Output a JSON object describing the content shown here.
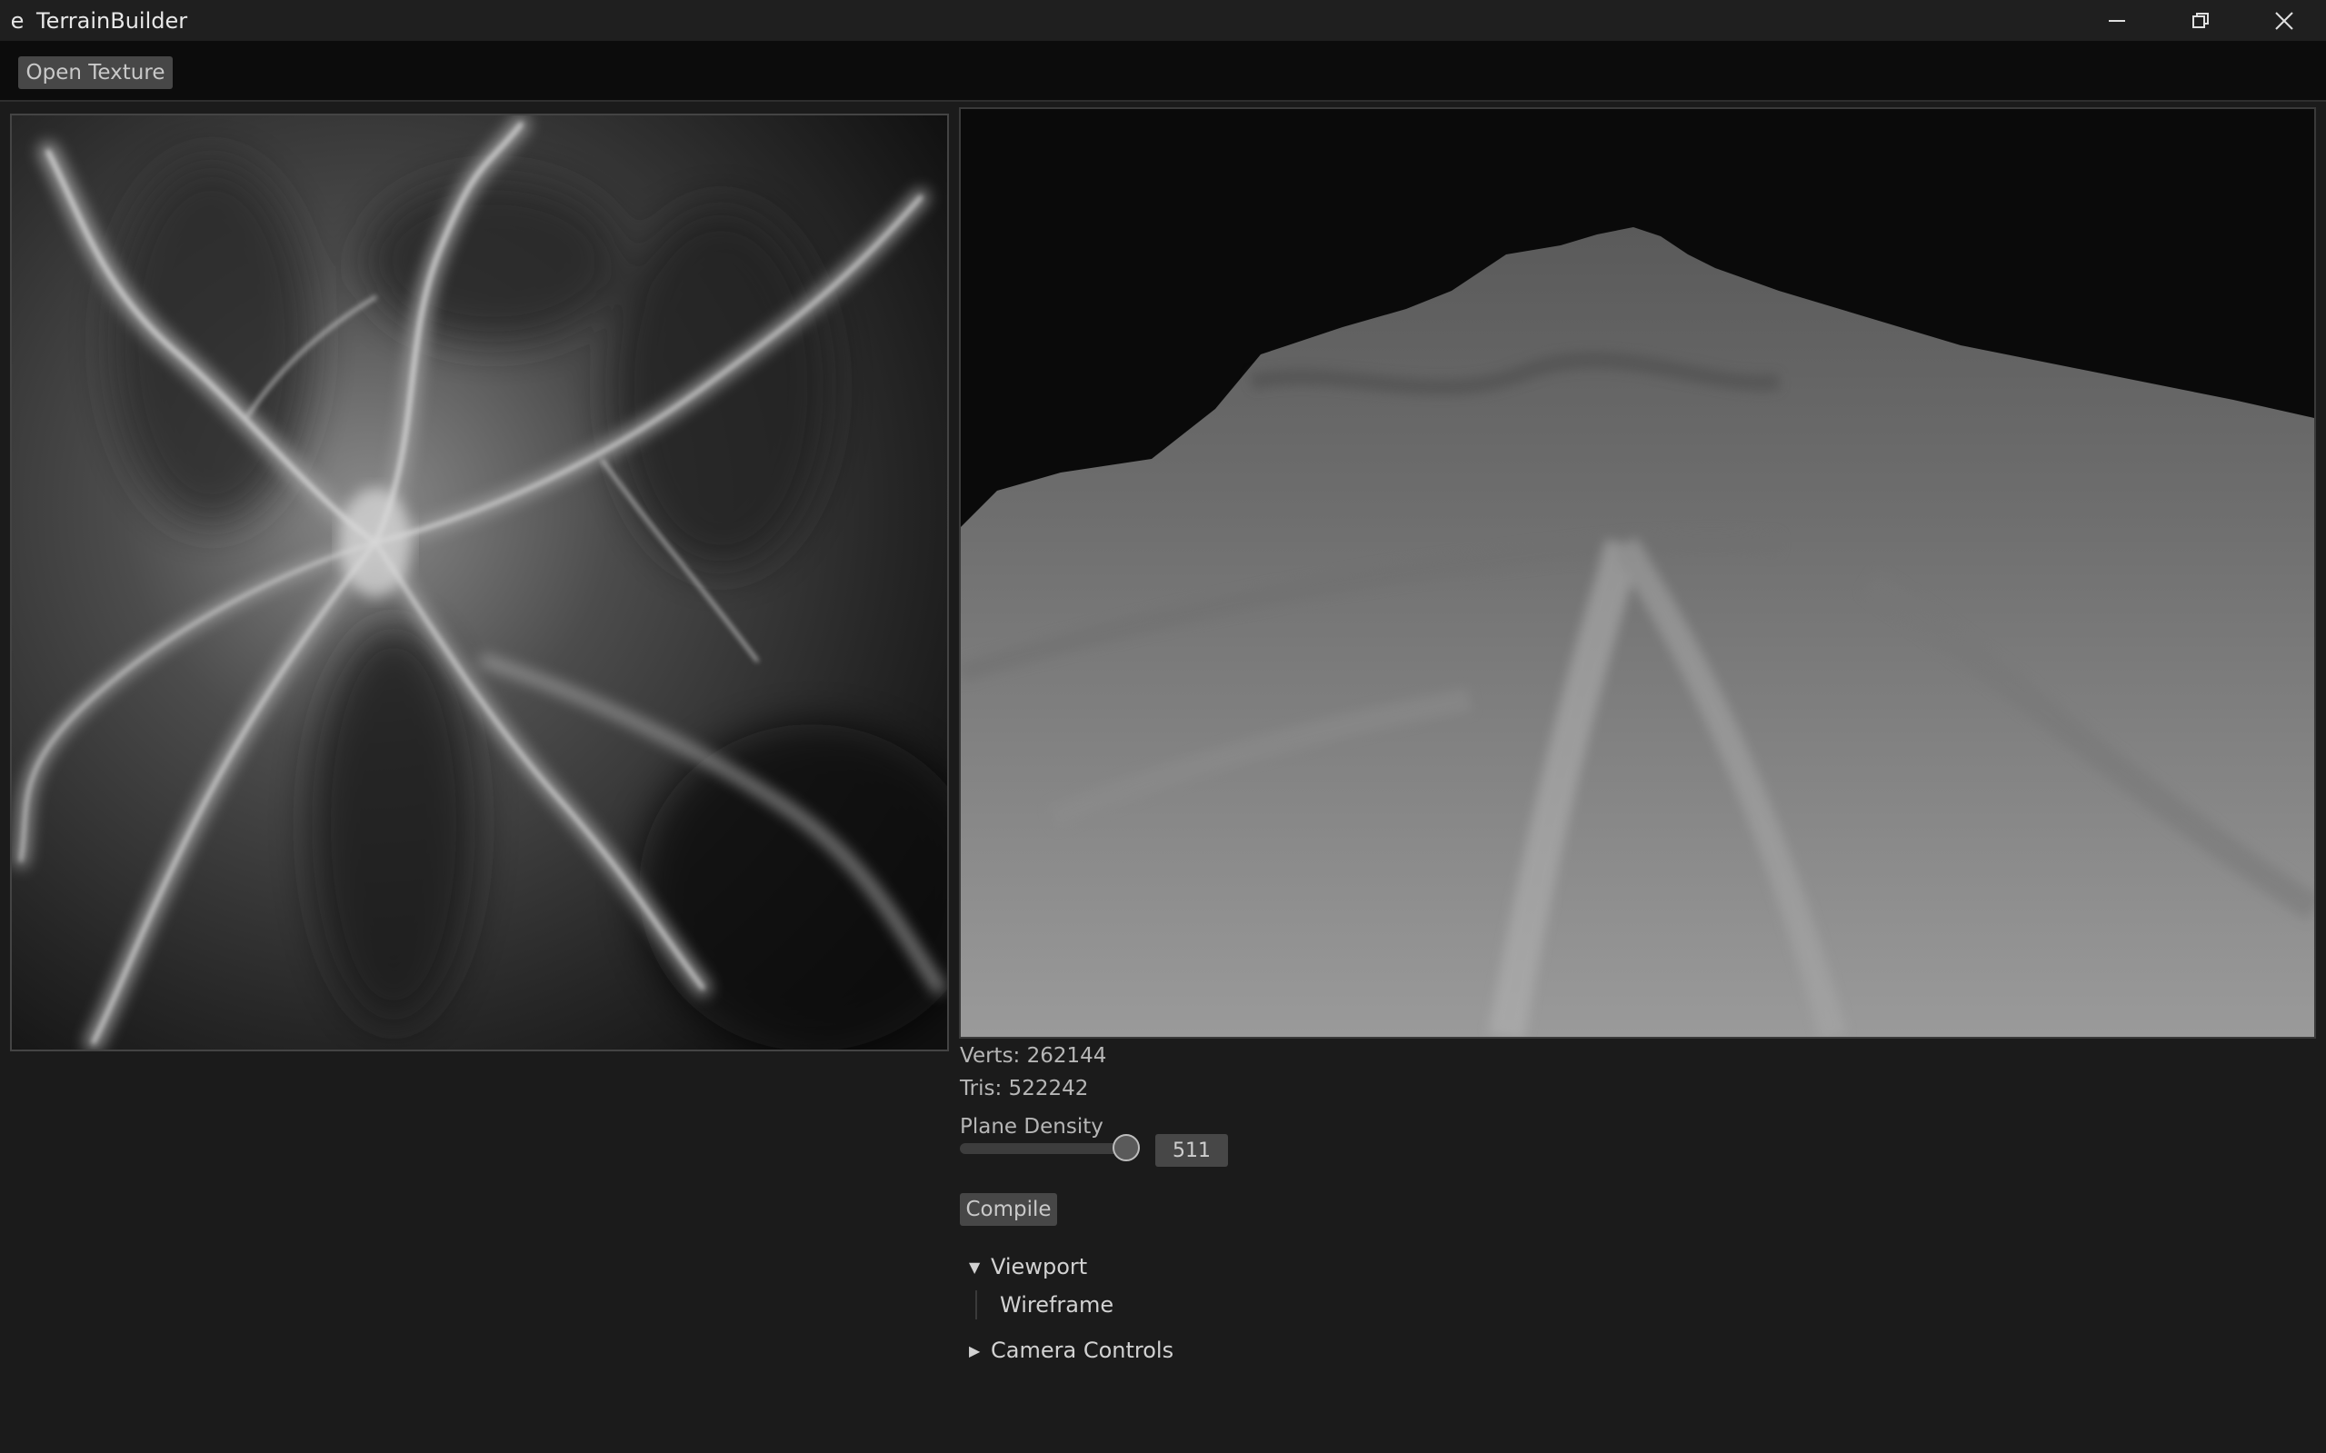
{
  "window": {
    "app_icon_glyph": "e",
    "title": "TerrainBuilder",
    "controls": [
      "minimize-icon",
      "restore-icon",
      "close-icon"
    ]
  },
  "toolbar": {
    "open_texture_label": "Open Texture"
  },
  "stats": {
    "verts": "Verts: 262144",
    "tris": "Tris: 522242"
  },
  "plane_density": {
    "label": "Plane Density",
    "value": "511",
    "slider_fraction": 1.0
  },
  "compile_label": "Compile",
  "tree": {
    "viewport": {
      "label": "Viewport",
      "expanded": true,
      "children": [
        "Wireframe"
      ]
    },
    "camera_controls": {
      "label": "Camera Controls",
      "expanded": false
    }
  }
}
